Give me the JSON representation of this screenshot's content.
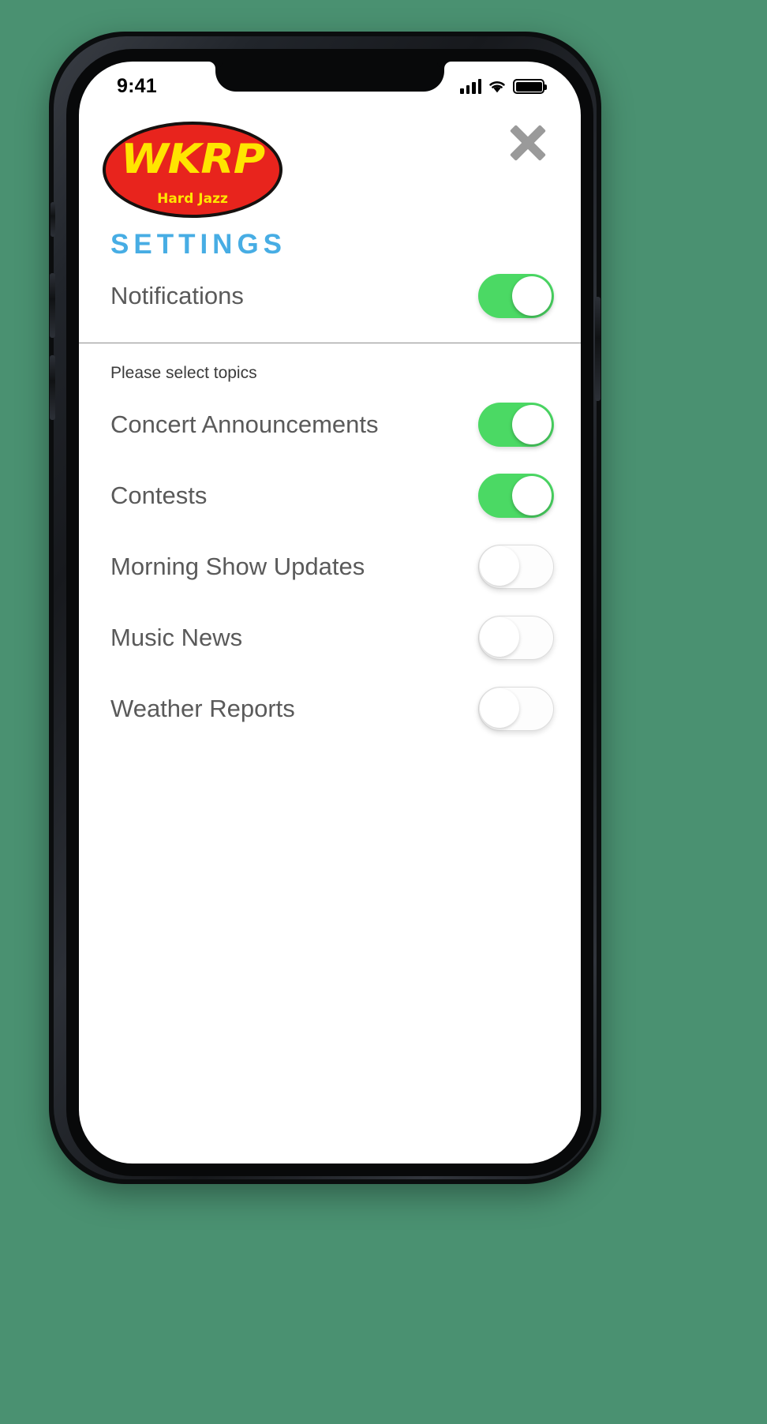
{
  "device": {
    "status_bar": {
      "time": "9:41",
      "signal_icon": "cellular-signal-icon",
      "wifi_icon": "wifi-icon",
      "battery_icon": "battery-full-icon"
    }
  },
  "app": {
    "logo": {
      "name": "WKRP",
      "tagline": "Hard Jazz",
      "badge_color": "#e8241d",
      "text_color": "#ffe500"
    },
    "close_label": "close-icon",
    "section_title": "SETTINGS",
    "accent_color": "#47ADE4",
    "toggle_on_color": "#4BD964",
    "notifications": {
      "label": "Notifications",
      "state": "on"
    },
    "topics_hint": "Please select topics",
    "topics": [
      {
        "label": "Concert Announcements",
        "state": "on"
      },
      {
        "label": "Contests",
        "state": "on"
      },
      {
        "label": "Morning Show Updates",
        "state": "off"
      },
      {
        "label": "Music News",
        "state": "off"
      },
      {
        "label": "Weather Reports",
        "state": "off"
      }
    ]
  }
}
